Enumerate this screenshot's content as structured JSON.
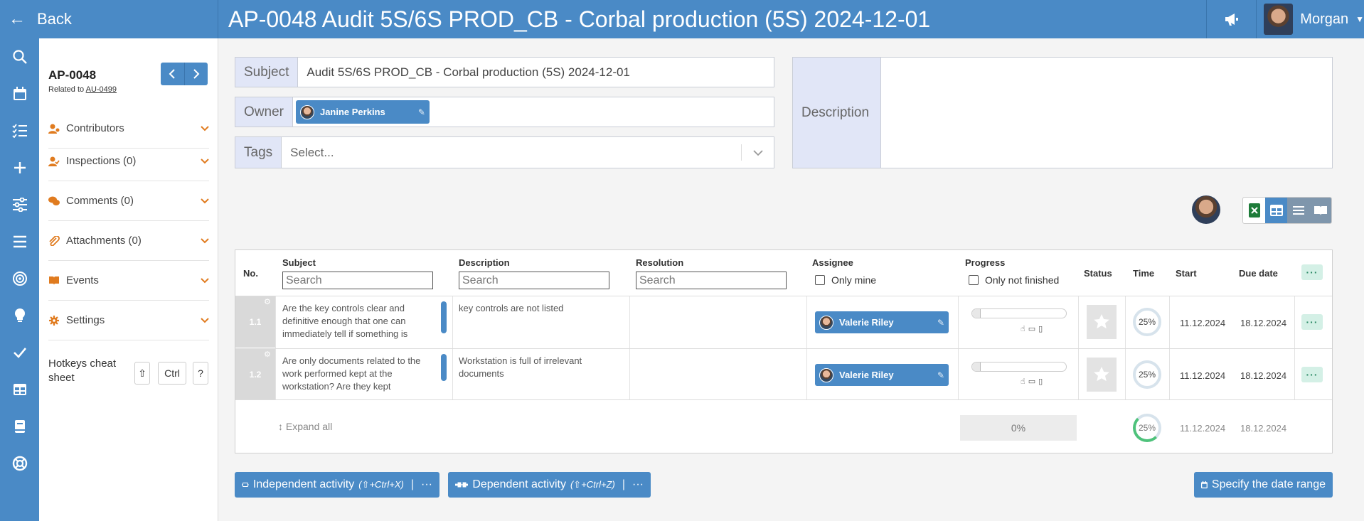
{
  "topbar": {
    "back_label": "Back",
    "title": "AP-0048 Audit 5S/6S PROD_CB - Corbal production (5S) 2024-12-01",
    "user_name": "Morgan"
  },
  "sidebar": {
    "id": "AP-0048",
    "related_prefix": "Related to",
    "related_link": "AU-0499",
    "sections": [
      {
        "label": "Contributors"
      },
      {
        "label": "Inspections (0)"
      },
      {
        "label": "Comments (0)"
      },
      {
        "label": "Attachments (0)"
      },
      {
        "label": "Events"
      },
      {
        "label": "Settings"
      }
    ],
    "hotkeys_label": "Hotkeys cheat sheet",
    "keys": [
      "⇧",
      "Ctrl",
      "?"
    ]
  },
  "form": {
    "subject_label": "Subject",
    "subject_value": "Audit 5S/6S PROD_CB - Corbal production (5S) 2024-12-01",
    "owner_label": "Owner",
    "owner_name": "Janine Perkins",
    "tags_label": "Tags",
    "tags_placeholder": "Select...",
    "description_label": "Description"
  },
  "table": {
    "headers": {
      "no": "No.",
      "subject": "Subject",
      "description": "Description",
      "resolution": "Resolution",
      "assignee": "Assignee",
      "progress": "Progress",
      "status": "Status",
      "time": "Time",
      "start": "Start",
      "due": "Due date"
    },
    "search_placeholder": "Search",
    "only_mine": "Only mine",
    "only_not_finished": "Only not finished",
    "rows": [
      {
        "no": "1.1",
        "subject": "Are the key controls clear and definitive enough that one can immediately tell if something is",
        "description": "key controls are not listed",
        "resolution": "",
        "assignee": "Valerie Riley",
        "progress": 0.05,
        "time": "25%",
        "start": "11.12.2024",
        "due": "18.12.2024"
      },
      {
        "no": "1.2",
        "subject": "Are only documents related to the work performed kept at the workstation? Are they kept",
        "description": "Workstation is full of irrelevant documents",
        "resolution": "",
        "assignee": "Valerie Riley",
        "progress": 0.05,
        "time": "25%",
        "start": "11.12.2024",
        "due": "18.12.2024"
      }
    ],
    "summary": {
      "expand_all": "Expand all",
      "progress": "0%",
      "time": "25%",
      "start": "11.12.2024",
      "due": "18.12.2024"
    }
  },
  "actions": {
    "independent_label": "Independent activity",
    "independent_hotkey": "(⇧+Ctrl+X)",
    "dependent_label": "Dependent activity",
    "dependent_hotkey": "(⇧+Ctrl+Z)",
    "date_range_label": "Specify the date range"
  },
  "colors": {
    "primary": "#4a8ac6",
    "label_bg": "#e1e6f7",
    "accent_orange": "#e07b1f",
    "success": "#4ec27b"
  }
}
